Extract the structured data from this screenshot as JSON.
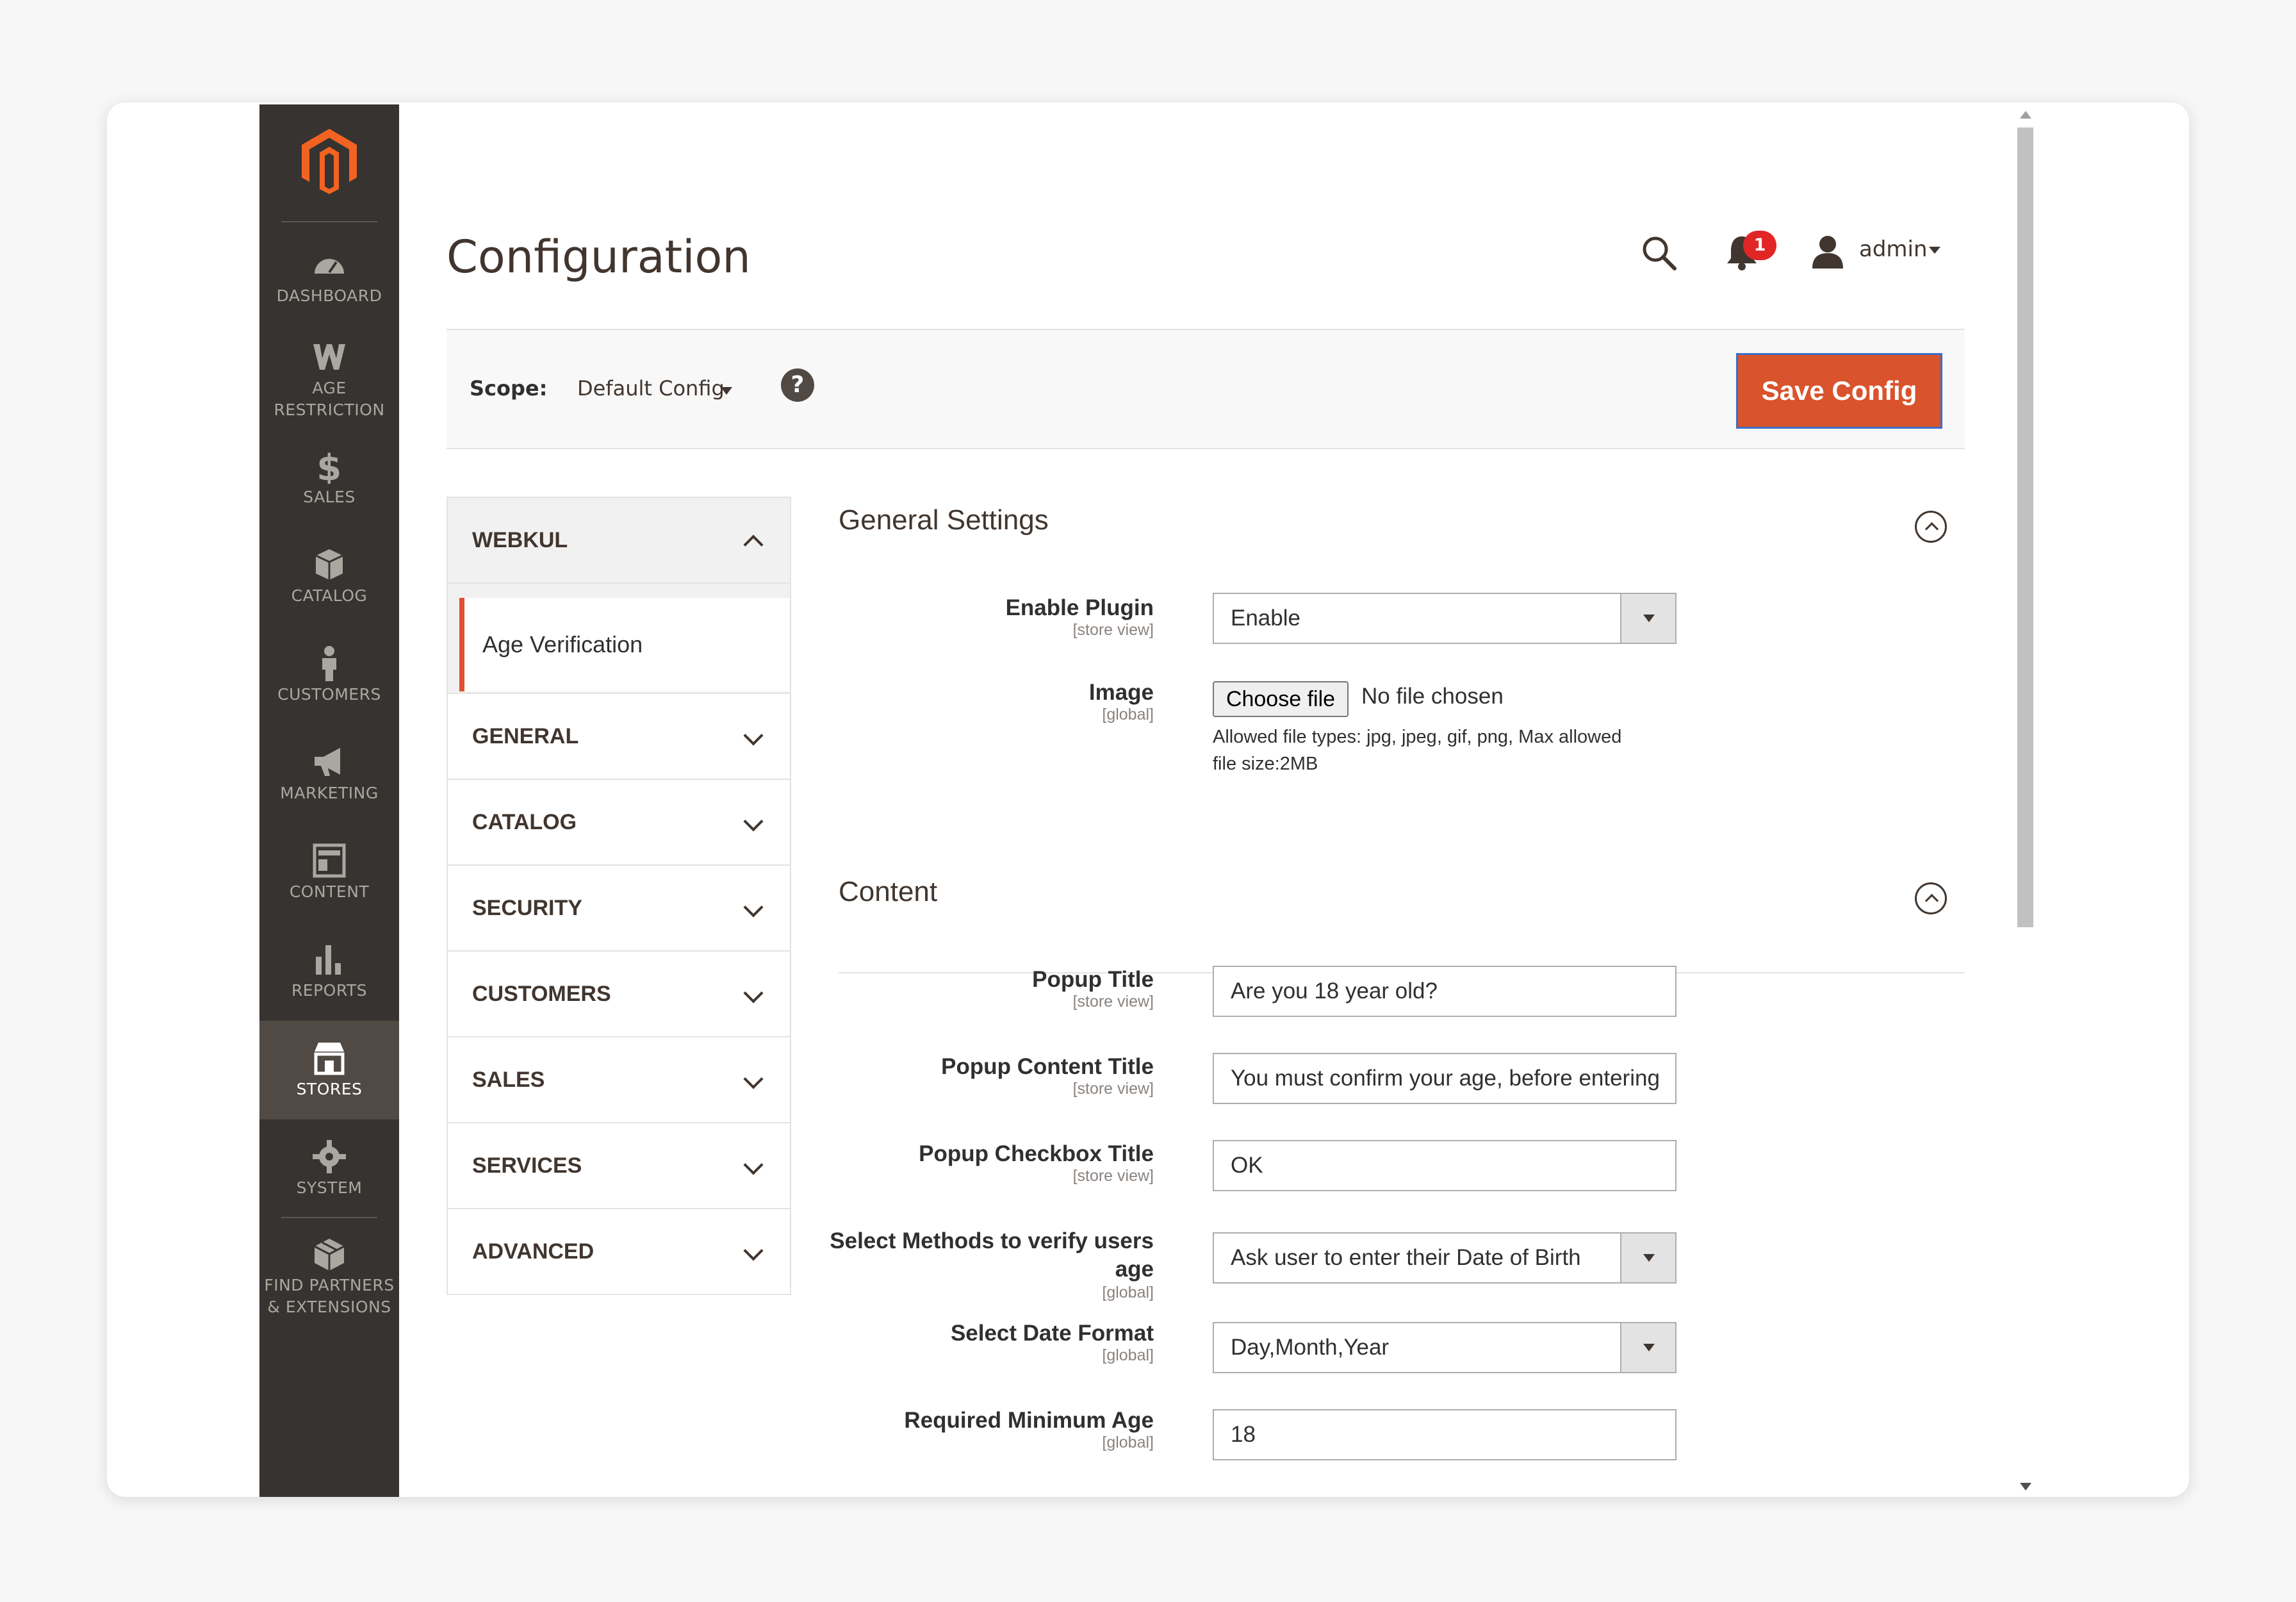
{
  "menu": {
    "items": [
      {
        "label": "DASHBOARD",
        "icon": "dashboard-icon"
      },
      {
        "label": "AGE RESTRICTION",
        "line1": "AGE",
        "line2": "RESTRICTION",
        "icon": "webkul-w-icon"
      },
      {
        "label": "SALES",
        "icon": "dollar-icon"
      },
      {
        "label": "CATALOG",
        "icon": "box-icon"
      },
      {
        "label": "CUSTOMERS",
        "icon": "person-icon"
      },
      {
        "label": "MARKETING",
        "icon": "megaphone-icon"
      },
      {
        "label": "CONTENT",
        "icon": "layout-icon"
      },
      {
        "label": "REPORTS",
        "icon": "bar-chart-icon"
      },
      {
        "label": "STORES",
        "icon": "store-icon",
        "active": true
      },
      {
        "label": "SYSTEM",
        "icon": "gear-icon"
      },
      {
        "label": "FIND PARTNERS & EXTENSIONS",
        "line1": "FIND PARTNERS",
        "line2": "& EXTENSIONS",
        "icon": "extensions-icon"
      }
    ]
  },
  "header": {
    "title": "Configuration",
    "notification_count": "1",
    "user": "admin"
  },
  "scope": {
    "label": "Scope:",
    "value": "Default Config",
    "help": "?",
    "save_label": "Save Config"
  },
  "tabs": {
    "webkul": "WEBKUL",
    "age_verification": "Age Verification",
    "general": "GENERAL",
    "catalog": "CATALOG",
    "security": "SECURITY",
    "customers": "CUSTOMERS",
    "sales": "SALES",
    "services": "SERVICES",
    "advanced": "ADVANCED"
  },
  "general_settings": {
    "title": "General Settings",
    "enable_plugin": {
      "label": "Enable Plugin",
      "scope": "[store view]",
      "value": "Enable"
    },
    "image": {
      "label": "Image",
      "scope": "[global]",
      "button": "Choose file",
      "status": "No file chosen",
      "note_line1": "Allowed file types: jpg, jpeg, gif, png, Max allowed",
      "note_line2": "file size:2MB"
    }
  },
  "content_section": {
    "title": "Content",
    "popup_title": {
      "label": "Popup Title",
      "scope": "[store view]",
      "value": "Are you 18 year old?"
    },
    "popup_content_title": {
      "label": "Popup Content Title",
      "scope": "[store view]",
      "value": "You must confirm your age, before entering"
    },
    "popup_checkbox_title": {
      "label": "Popup Checkbox Title",
      "scope": "[store view]",
      "value": "OK"
    },
    "verify_method": {
      "label_line1": "Select Methods to verify users",
      "label_line2": "age",
      "scope": "[global]",
      "value": "Ask user to enter their Date of Birth"
    },
    "date_format": {
      "label": "Select Date Format",
      "scope": "[global]",
      "value": "Day,Month,Year"
    },
    "min_age": {
      "label": "Required Minimum Age",
      "scope": "[global]",
      "value": "18"
    }
  },
  "colors": {
    "menu_bg": "#373330",
    "menu_active": "#514943",
    "accent": "#e04f32",
    "logo": "#f26322"
  }
}
